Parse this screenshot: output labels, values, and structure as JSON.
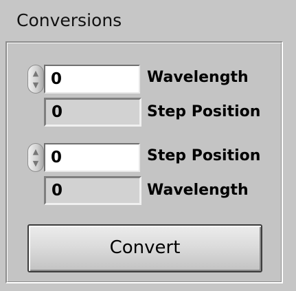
{
  "panel": {
    "title": "Conversions"
  },
  "converter_1": {
    "input_value": "0",
    "input_label": "Wavelength",
    "output_value": "0",
    "output_label": "Step Position"
  },
  "converter_2": {
    "input_value": "0",
    "input_label": "Step Position",
    "output_value": "0",
    "output_label": "Wavelength"
  },
  "spinner": {
    "up_glyph": "▲",
    "down_glyph": "▼",
    "up_icon": "increment-arrow-icon",
    "down_icon": "decrement-arrow-icon"
  },
  "actions": {
    "convert_label": "Convert"
  }
}
